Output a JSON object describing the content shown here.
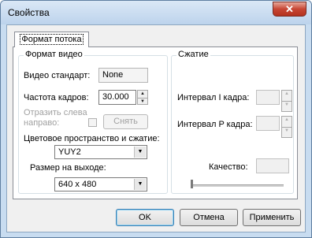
{
  "window": {
    "title": "Свойства",
    "close_glyph": "✕"
  },
  "tab": {
    "label": "Формат потока"
  },
  "video_group": {
    "title": "Формат видео",
    "standard_label": "Видео стандарт:",
    "standard_value": "None",
    "framerate_label": "Частота кадров:",
    "framerate_value": "30.000",
    "mirror_label_line1": "Отразить слева",
    "mirror_label_line2": "направо:",
    "remove_button": "Снять",
    "colorspace_label": "Цветовое пространство и сжатие:",
    "colorspace_value": "YUY2",
    "output_size_label": "Размер на выходе:",
    "output_size_value": "640 x 480"
  },
  "compression_group": {
    "title": "Сжатие",
    "i_frame_label": "Интервал I кадра:",
    "p_frame_label": "Интервал P кадра:",
    "quality_label": "Качество:"
  },
  "buttons": {
    "ok": "OK",
    "cancel": "Отмена",
    "apply": "Применить"
  }
}
